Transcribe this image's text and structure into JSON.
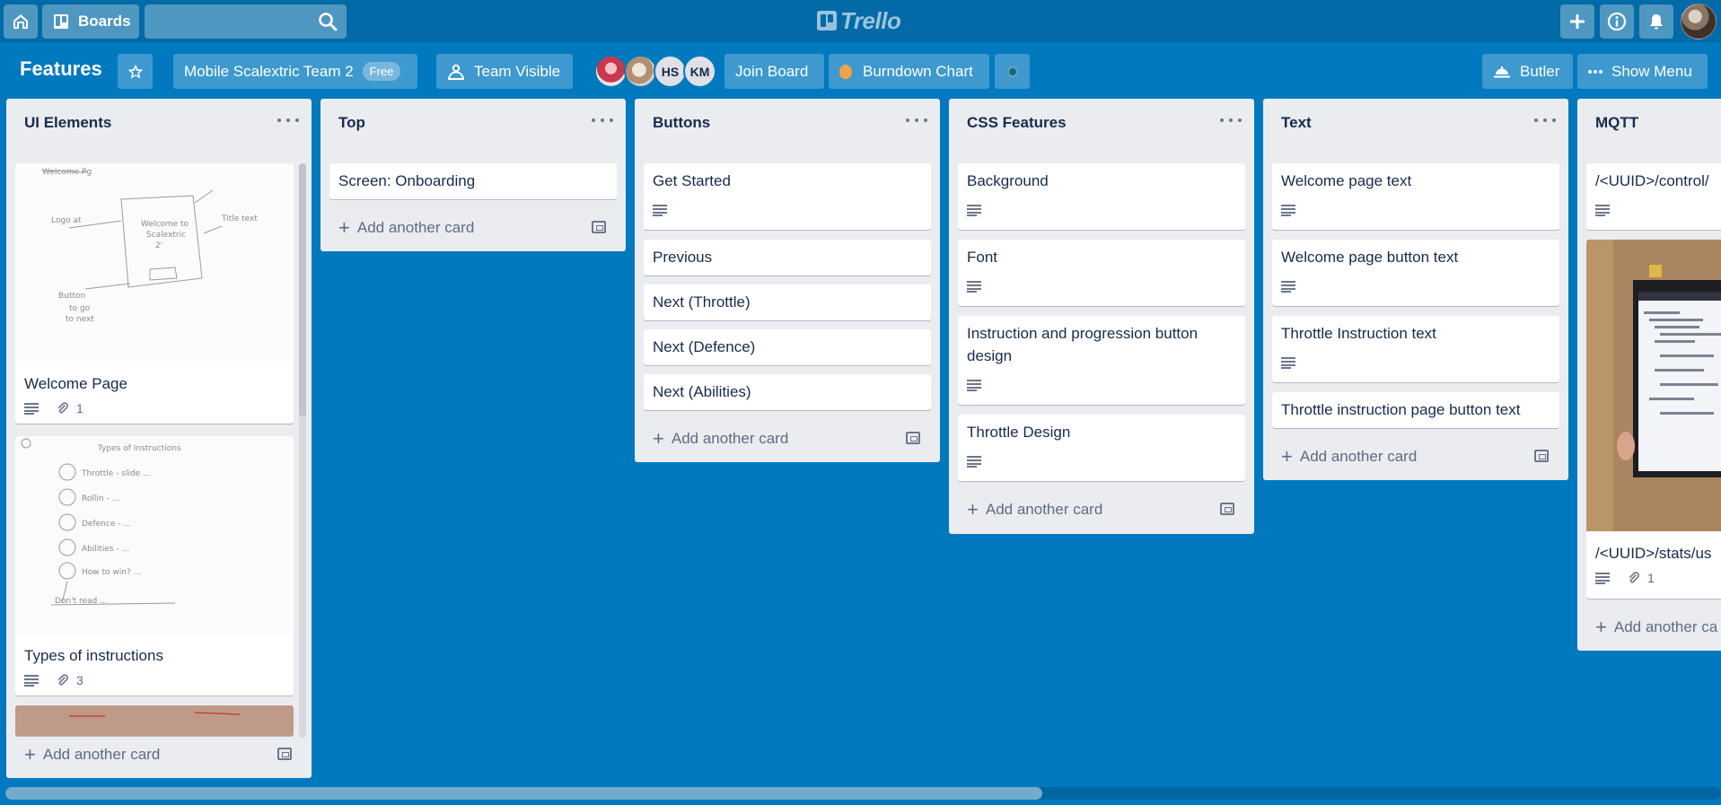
{
  "topbar": {
    "boards_label": "Boards",
    "search_placeholder": "",
    "logo_text": "Trello"
  },
  "board": {
    "title": "Features",
    "team_name": "Mobile Scalextric Team 2",
    "team_badge": "Free",
    "visibility": "Team Visible",
    "members": [
      "",
      "",
      "HS",
      "KM"
    ],
    "join_label": "Join Board",
    "burndown_label": "Burndown Chart",
    "butler_label": "Butler",
    "menu_label": "Show Menu"
  },
  "add_card_label": "Add another card",
  "lists": [
    {
      "title": "UI Elements",
      "cards": [
        {
          "title": "Welcome Page",
          "description": true,
          "attachments": "1"
        },
        {
          "title": "Types of instructions",
          "description": true,
          "attachments": "3"
        }
      ]
    },
    {
      "title": "Top",
      "cards": [
        {
          "title": "Screen: Onboarding"
        }
      ]
    },
    {
      "title": "Buttons",
      "cards": [
        {
          "title": "Get Started",
          "description": true
        },
        {
          "title": "Previous"
        },
        {
          "title": "Next (Throttle)"
        },
        {
          "title": "Next (Defence)"
        },
        {
          "title": "Next (Abilities)"
        }
      ]
    },
    {
      "title": "CSS Features",
      "cards": [
        {
          "title": "Background",
          "description": true
        },
        {
          "title": "Font",
          "description": true
        },
        {
          "title": "Instruction and progression button design",
          "description": true
        },
        {
          "title": "Throttle Design",
          "description": true
        }
      ]
    },
    {
      "title": "Text",
      "cards": [
        {
          "title": "Welcome page text",
          "description": true
        },
        {
          "title": "Welcome page button text",
          "description": true
        },
        {
          "title": "Throttle Instruction text",
          "description": true
        },
        {
          "title": "Throttle instruction page button text"
        }
      ]
    },
    {
      "title": "MQTT",
      "cards": [
        {
          "title": "/<UUID>/control/",
          "description": true
        },
        {
          "title": "/<UUID>/stats/us",
          "description": true,
          "attachments": "1"
        }
      ],
      "add_card_label": "Add another ca"
    }
  ],
  "colors": {
    "board_bg": "#0079bf",
    "header_bg": "#026aa7",
    "list_bg": "#ebecf0",
    "text": "#172b4d"
  }
}
